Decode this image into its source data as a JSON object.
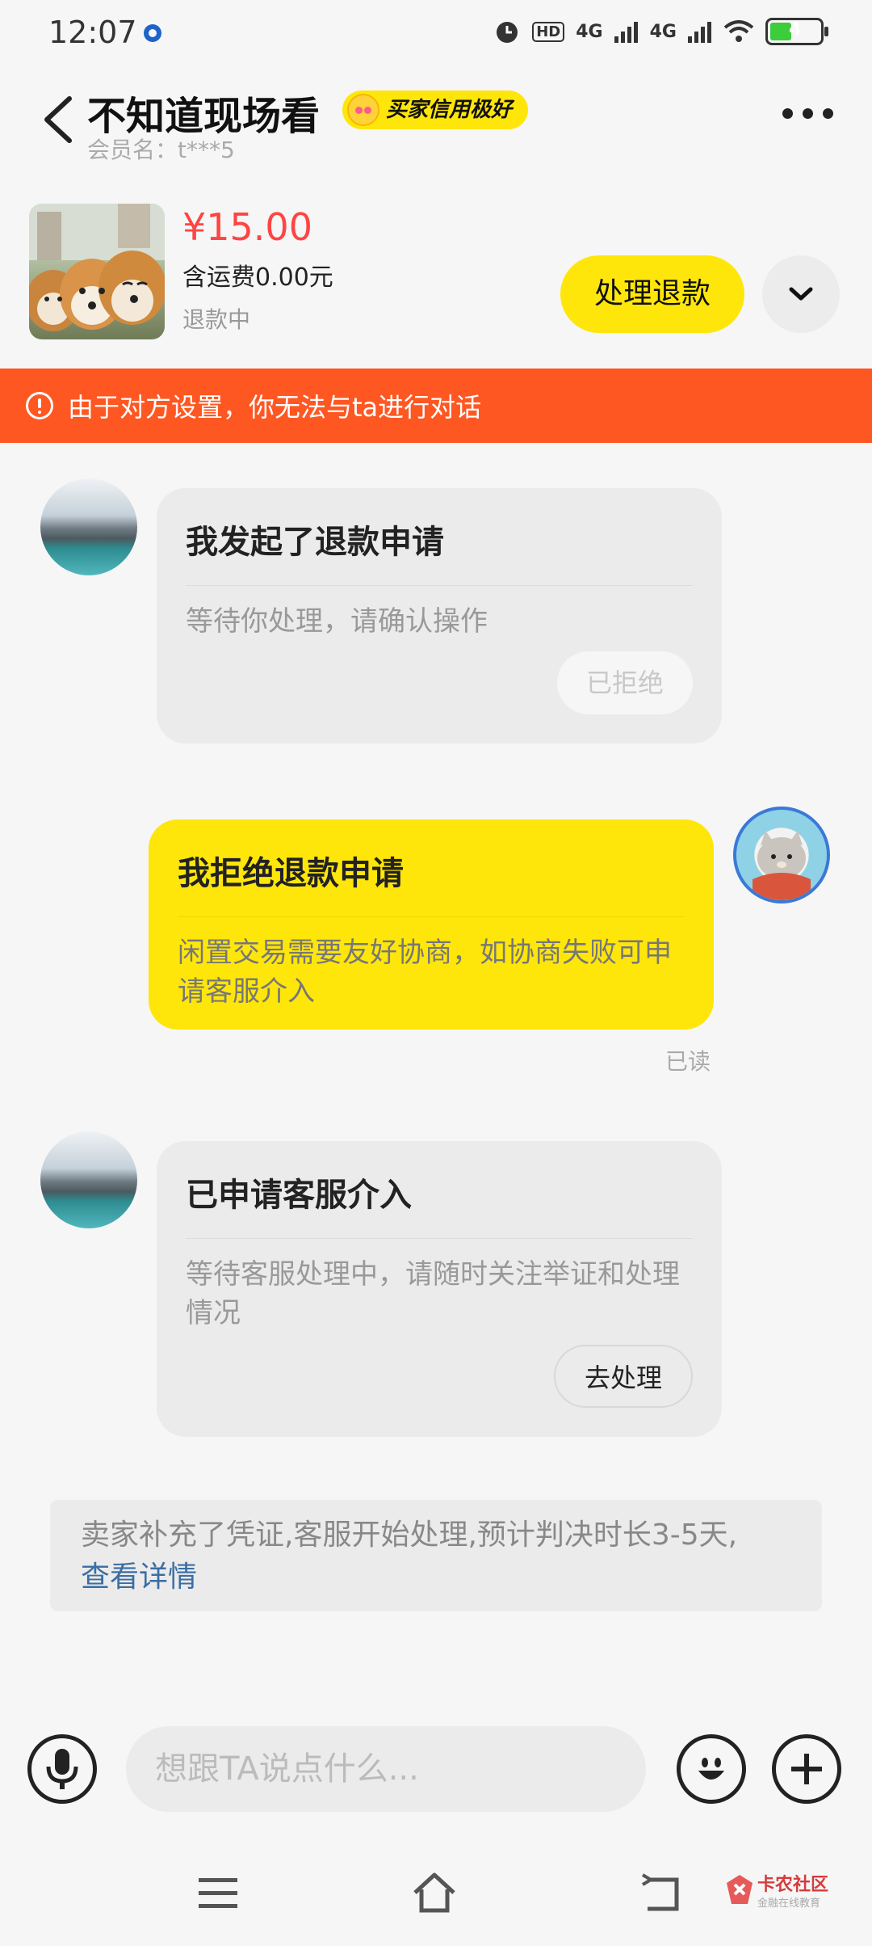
{
  "status_bar": {
    "time": "12:07",
    "network_1": "4G",
    "network_2": "4G",
    "hd": "HD",
    "battery": "4"
  },
  "header": {
    "title": "不知道现场看",
    "credit_badge": "买家信用极好",
    "member_label": "会员名：t***5"
  },
  "product": {
    "price": "¥15.00",
    "shipping": "含运费0.00元",
    "status": "退款中",
    "refund_button": "处理退款"
  },
  "notice": {
    "text": "由于对方设置，你无法与ta进行对话"
  },
  "messages": [
    {
      "title": "我发起了退款申请",
      "text": "等待你处理，请确认操作",
      "button": "已拒绝"
    },
    {
      "title": "我拒绝退款申请",
      "text": "闲置交易需要友好协商，如协商失败可申请客服介入",
      "read": "已读"
    },
    {
      "title": "已申请客服介入",
      "text": "等待客服处理中，请随时关注举证和处理情况",
      "button": "去处理"
    }
  ],
  "system_message": {
    "text": "卖家补充了凭证,客服开始处理,预计判决时长3-5天,",
    "link": "查看详情"
  },
  "input": {
    "placeholder": "想跟TA说点什么..."
  },
  "watermark": {
    "title": "卡农社区",
    "subtitle": "金融在线教育"
  },
  "colors": {
    "accent_yellow": "#ffe60a",
    "notice_orange": "#ff5722",
    "price_red": "#ff4444",
    "link_blue": "#3a6ea5"
  }
}
